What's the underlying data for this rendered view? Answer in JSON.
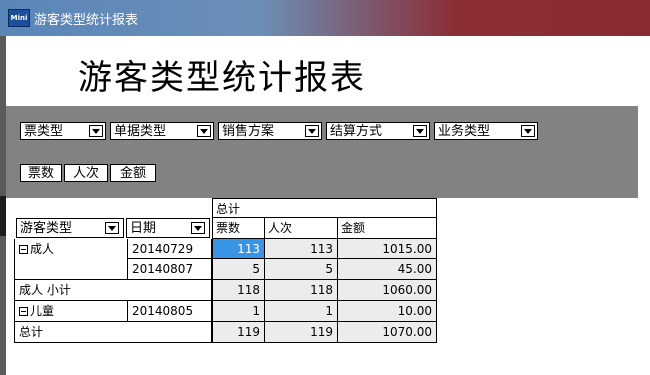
{
  "window": {
    "title": "游客类型统计报表",
    "icon": "app-icon"
  },
  "report": {
    "title": "游客类型统计报表"
  },
  "filter_fields": [
    {
      "label": "票类型"
    },
    {
      "label": "单据类型"
    },
    {
      "label": "销售方案"
    },
    {
      "label": "结算方式"
    },
    {
      "label": "业务类型"
    }
  ],
  "value_fields": [
    "票数",
    "人次",
    "金额"
  ],
  "row_fields": [
    "游客类型",
    "日期"
  ],
  "table": {
    "total_header": "总计",
    "columns": [
      "票数",
      "人次",
      "金额"
    ],
    "rows": [
      {
        "group": "成人",
        "date": "20140729",
        "values": [
          "113",
          "113",
          "1015.00"
        ]
      },
      {
        "group": "",
        "date": "20140807",
        "values": [
          "5",
          "5",
          "45.00"
        ]
      },
      {
        "label": "成人 小计",
        "values": [
          "118",
          "118",
          "1060.00"
        ]
      },
      {
        "group": "儿童",
        "date": "20140805",
        "values": [
          "1",
          "1",
          "10.00"
        ]
      },
      {
        "label": "总计",
        "values": [
          "119",
          "119",
          "1070.00"
        ]
      }
    ]
  },
  "colors": {
    "band": "#828282",
    "selected": "#3a94e6"
  }
}
